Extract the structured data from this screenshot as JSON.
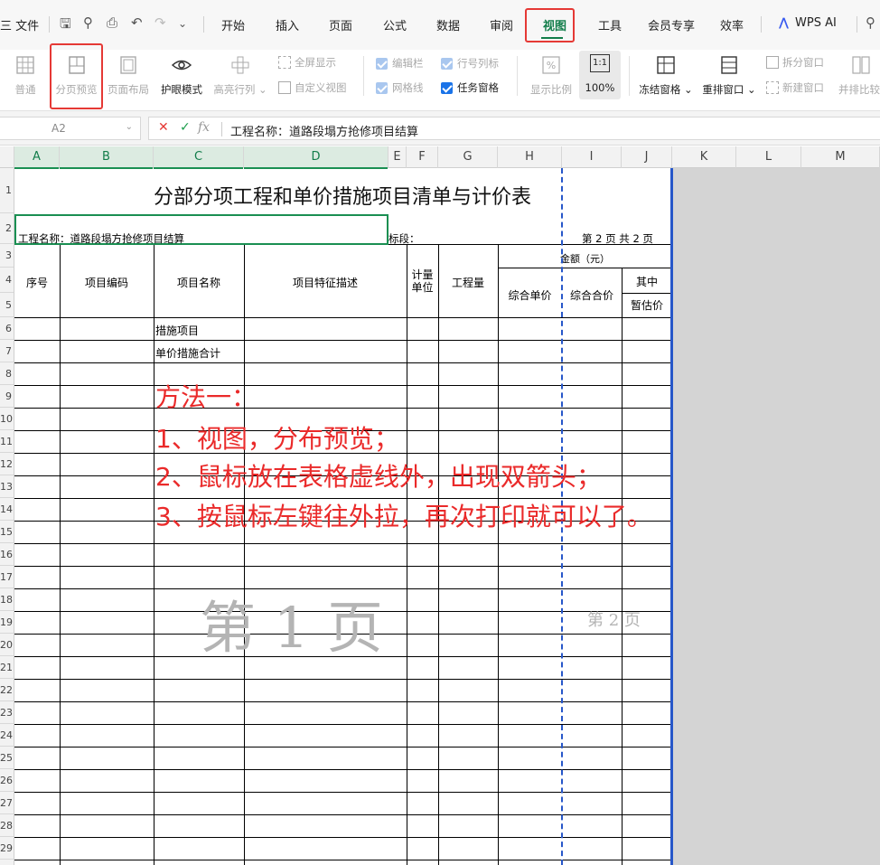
{
  "menu": {
    "file": "三 文件",
    "tabs": [
      "开始",
      "插入",
      "页面",
      "公式",
      "数据",
      "审阅",
      "视图",
      "工具",
      "会员专享",
      "效率"
    ],
    "wps_ai": "WPS AI"
  },
  "ribbon": {
    "normal": "普通",
    "page_break_preview": "分页预览",
    "page_layout": "页面布局",
    "eye_protection": "护眼模式",
    "highlight_row_col": "高亮行列",
    "full_screen": "全屏显示",
    "custom_view": "自定义视图",
    "edit_bar": "编辑栏",
    "row_col_header": "行号列标",
    "gridlines": "网格线",
    "task_pane": "任务窗格",
    "zoom_ratio": "显示比例",
    "zoom_100": "100%",
    "zoom_100_icon": "1:1",
    "freeze_panes": "冻结窗格",
    "rearrange_windows": "重排窗口",
    "split_window": "拆分窗口",
    "new_window": "新建窗口",
    "side_by_side": "并排比较"
  },
  "formula_bar": {
    "cell_ref": "A2",
    "fx": "fx",
    "value": "工程名称：道路段塌方抢修项目结算"
  },
  "columns": [
    "A",
    "B",
    "C",
    "D",
    "E",
    "F",
    "G",
    "H",
    "I",
    "J",
    "K",
    "L",
    "M"
  ],
  "rows": [
    "1",
    "2",
    "3",
    "4",
    "5",
    "6",
    "7",
    "8",
    "9",
    "10",
    "11",
    "12",
    "13",
    "14",
    "15",
    "16",
    "17",
    "18",
    "19",
    "20",
    "21",
    "22",
    "23",
    "24",
    "25",
    "26",
    "27",
    "28",
    "29"
  ],
  "sheet": {
    "title": "分部分项工程和单价措施项目清单与计价表",
    "project_name": "工程名称：道路段塌方抢修项目结算",
    "section": "标段：",
    "page_info": "第 2 页   共 2 页",
    "headers": {
      "seq": "序号",
      "code": "项目编码",
      "name": "项目名称",
      "desc": "项目特征描述",
      "unit_line1": "计量",
      "unit_line2": "单位",
      "quantity": "工程量",
      "amount": "金额（元）",
      "unit_price": "综合单价",
      "total_price": "综合合价",
      "of_which": "其中",
      "provisional": "暂估价"
    },
    "rows": [
      "措施项目",
      "单价措施合计"
    ],
    "watermark_page1": "第 1 页",
    "watermark_page2": "第 2 页"
  },
  "annotation": {
    "line1": "方法一：",
    "line2": "1、视图，分布预览；",
    "line3": "2、鼠标放在表格虚线外，出现双箭头；",
    "line4": "3、按鼠标左键往外拉，再次打印就可以了。"
  },
  "colors": {
    "accent_green": "#127d4a",
    "highlight_red": "#e53935",
    "page_border_blue": "#2757c9"
  }
}
